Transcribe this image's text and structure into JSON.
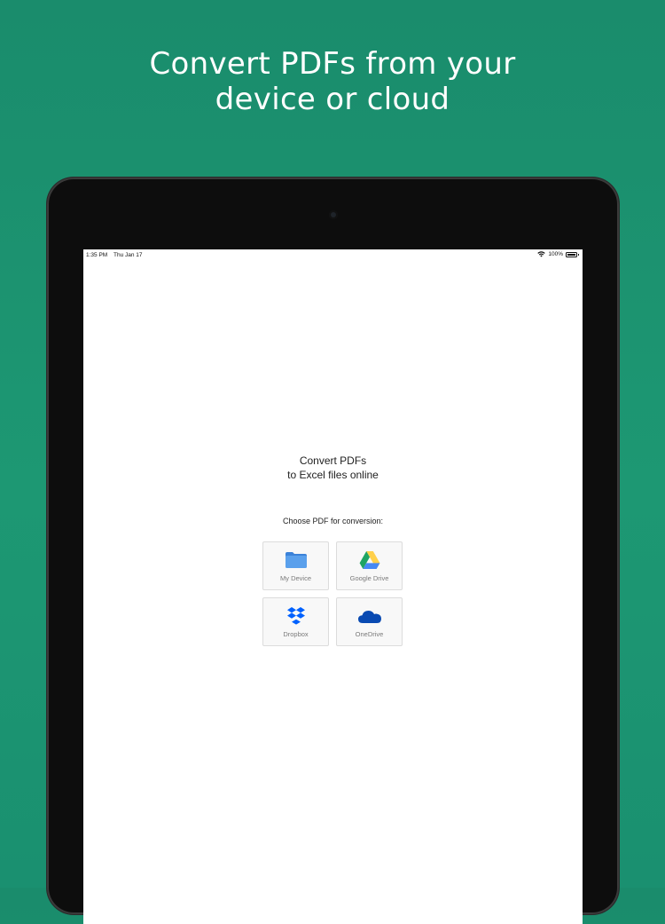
{
  "headline": {
    "line1": "Convert PDFs from your",
    "line2": "device or cloud"
  },
  "status_bar": {
    "time": "1:35 PM",
    "date": "Thu Jan 17",
    "battery": "100%",
    "battery_level": 1.0
  },
  "main": {
    "intro_line1": "Convert PDFs",
    "intro_line2": "to Excel files online",
    "choose_label": "Choose PDF for conversion:"
  },
  "sources": [
    {
      "label": "My Device",
      "icon": "folder-icon"
    },
    {
      "label": "Google Drive",
      "icon": "google-drive-icon"
    },
    {
      "label": "Dropbox",
      "icon": "dropbox-icon"
    },
    {
      "label": "OneDrive",
      "icon": "onedrive-icon"
    }
  ],
  "colors": {
    "background": "#1d9873",
    "folder_blue": "#4a90e2",
    "drive_green": "#1fa463",
    "drive_yellow": "#ffd04b",
    "drive_blue": "#4688f4",
    "dropbox_blue": "#0061fe",
    "onedrive_blue": "#094ab2"
  }
}
